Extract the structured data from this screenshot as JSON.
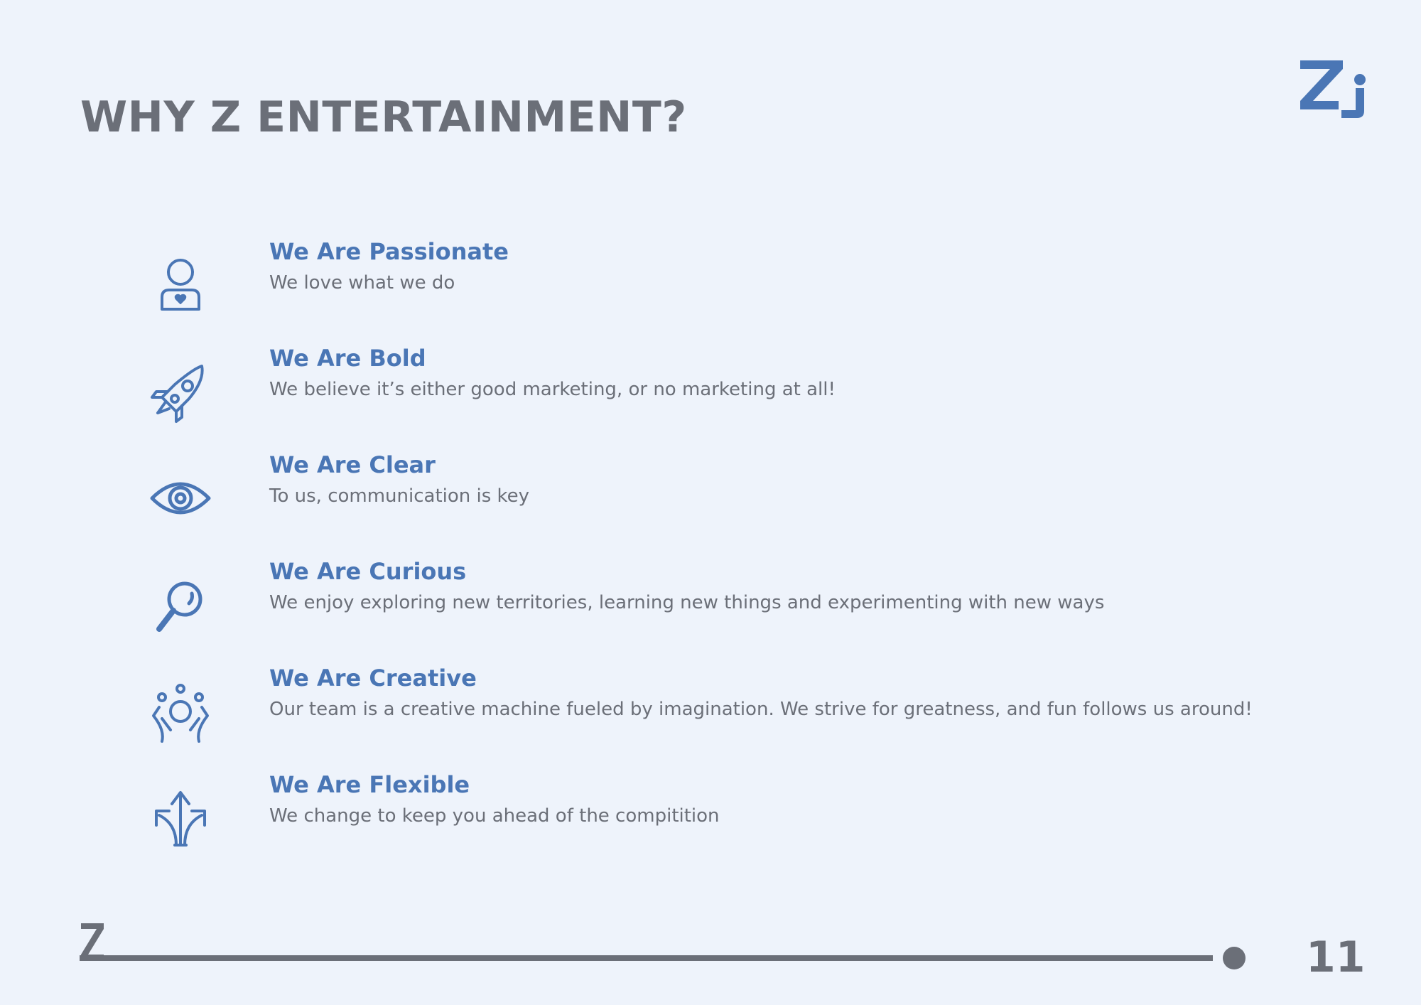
{
  "slide": {
    "title": "WHY Z ENTERTAINMENT?",
    "logo_text": "Zi",
    "footer_mark": "Z",
    "page_number": "11"
  },
  "items": [
    {
      "icon": "person-heart-icon",
      "title": "We Are Passionate",
      "desc": "We love what we do"
    },
    {
      "icon": "rocket-icon",
      "title": "We Are Bold",
      "desc": "We believe it’s either good marketing, or no marketing at all!"
    },
    {
      "icon": "eye-icon",
      "title": "We Are Clear",
      "desc": "To us, communication is key"
    },
    {
      "icon": "magnifying-glass-icon",
      "title": "We Are Curious",
      "desc": "We enjoy exploring new territories, learning new things and experimenting with new ways"
    },
    {
      "icon": "creative-person-icon",
      "title": "We Are Creative",
      "desc": "Our team is a creative machine fueled by imagination. We strive for greatness, and fun follows us around!"
    },
    {
      "icon": "split-arrows-icon",
      "title": "We Are Flexible",
      "desc": "We change to keep you ahead of the compitition"
    }
  ],
  "colors": {
    "background": "#eef3fb",
    "accent": "#4a76b5",
    "text": "#6b6f78"
  }
}
